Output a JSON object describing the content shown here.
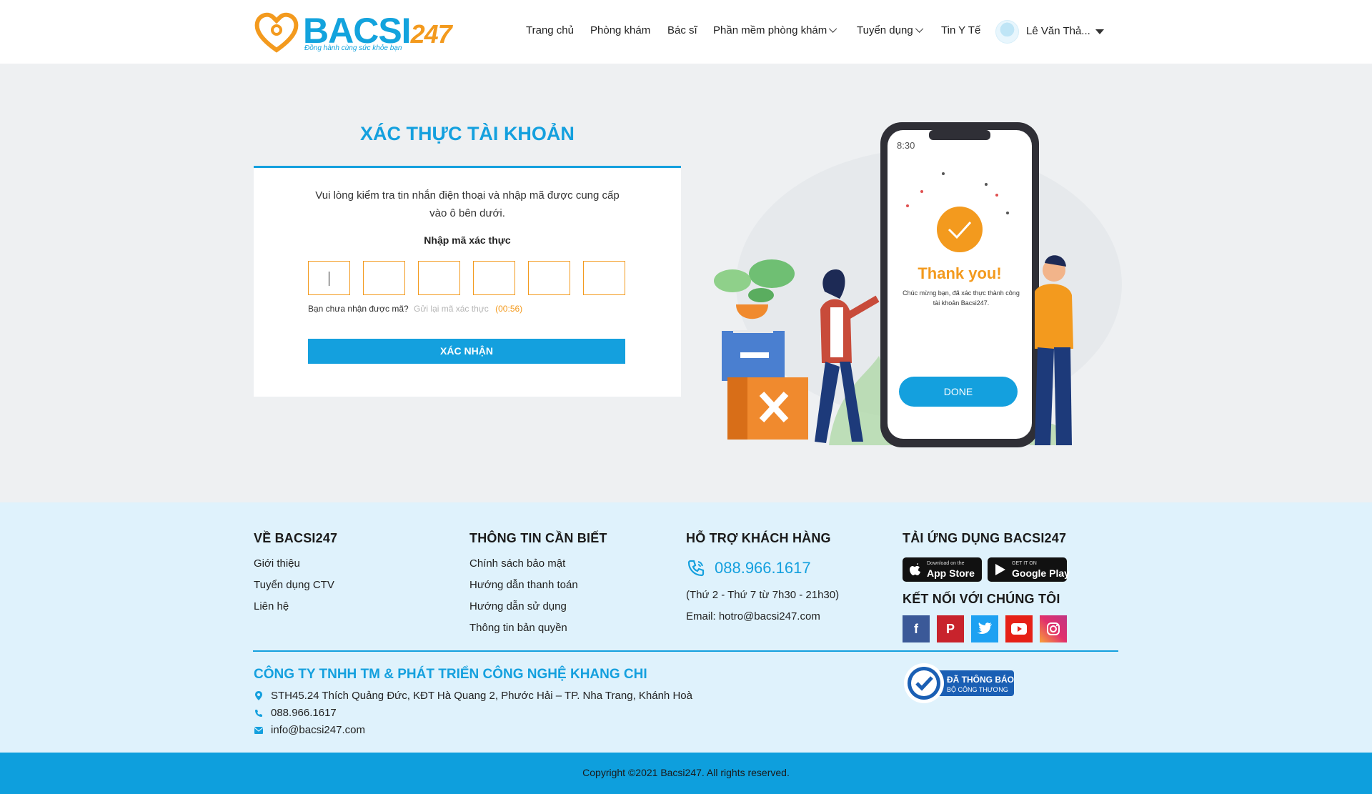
{
  "header": {
    "logo_text": "BACSI",
    "logo_num": "247",
    "logo_tagline": "Đồng hành cùng sức khỏe bạn",
    "nav": [
      {
        "label": "Trang chủ",
        "dropdown": false
      },
      {
        "label": "Phòng khám",
        "dropdown": false
      },
      {
        "label": "Bác sĩ",
        "dropdown": false
      },
      {
        "label": "Phần mềm phòng khám",
        "dropdown": true
      },
      {
        "label": "Tuyển dụng",
        "dropdown": true
      },
      {
        "label": "Tin Y Tế",
        "dropdown": false
      }
    ],
    "user_name": "Lê Văn Thả..."
  },
  "verify": {
    "title": "XÁC THỰC TÀI KHOẢN",
    "instruction": "Vui lòng kiểm tra tin nhắn điện thoại và nhập mã được cung cấp vào ô bên dưới.",
    "code_label": "Nhập mã xác thực",
    "code_digits": [
      "",
      "",
      "",
      "",
      "",
      ""
    ],
    "not_received": "Bạn chưa nhận được mã?",
    "resend_link": "Gửi lại mã xác thực",
    "timer": "(00:56)",
    "confirm_button": "XÁC NHẬN"
  },
  "illustration": {
    "phone_time": "8:30",
    "thank_you": "Thank you!",
    "message_line1": "Chúc mừng bạn, đã xác thực thành công",
    "message_line2": "tài khoản Bacsi247.",
    "done_button": "DONE"
  },
  "footer": {
    "about": {
      "heading": "VỀ BACSI247",
      "links": [
        "Giới thiệu",
        "Tuyển dụng CTV",
        "Liên hệ"
      ]
    },
    "info": {
      "heading": "THÔNG TIN CẦN BIẾT",
      "links": [
        "Chính sách bảo mật",
        "Hướng dẫn thanh toán",
        "Hướng dẫn sử dụng",
        "Thông tin bản quyền"
      ]
    },
    "support": {
      "heading": "HỖ TRỢ KHÁCH HÀNG",
      "phone": "088.966.1617",
      "hours": "(Thứ 2 - Thứ 7 từ 7h30 - 21h30)",
      "email": "Email: hotro@bacsi247.com"
    },
    "app": {
      "heading": "TẢI ỨNG DỤNG BACSI247",
      "appstore_small": "Download on the",
      "appstore_big": "App Store",
      "googleplay_small": "GET IT ON",
      "googleplay_big": "Google Play",
      "connect_heading": "KẾT NỐI VỚI CHÚNG TÔI"
    },
    "company": {
      "name": "CÔNG TY TNHH TM & PHÁT TRIỂN CÔNG NGHỆ KHANG CHI",
      "address": "STH45.24 Thích Quảng Đức, KĐT Hà Quang 2, Phước Hải – TP. Nha Trang, Khánh Hoà",
      "phone": "088.966.1617",
      "email": "info@bacsi247.com"
    },
    "badge_line1": "ĐÃ THÔNG BÁO",
    "badge_line2": "BỘ CÔNG THƯƠNG",
    "copyright": "Copyright ©2021 Bacsi247. All rights reserved."
  },
  "colors": {
    "primary": "#14a0de",
    "accent": "#f39a1e",
    "footer_bg": "#dff2fc",
    "page_bg": "#eef0f2"
  }
}
